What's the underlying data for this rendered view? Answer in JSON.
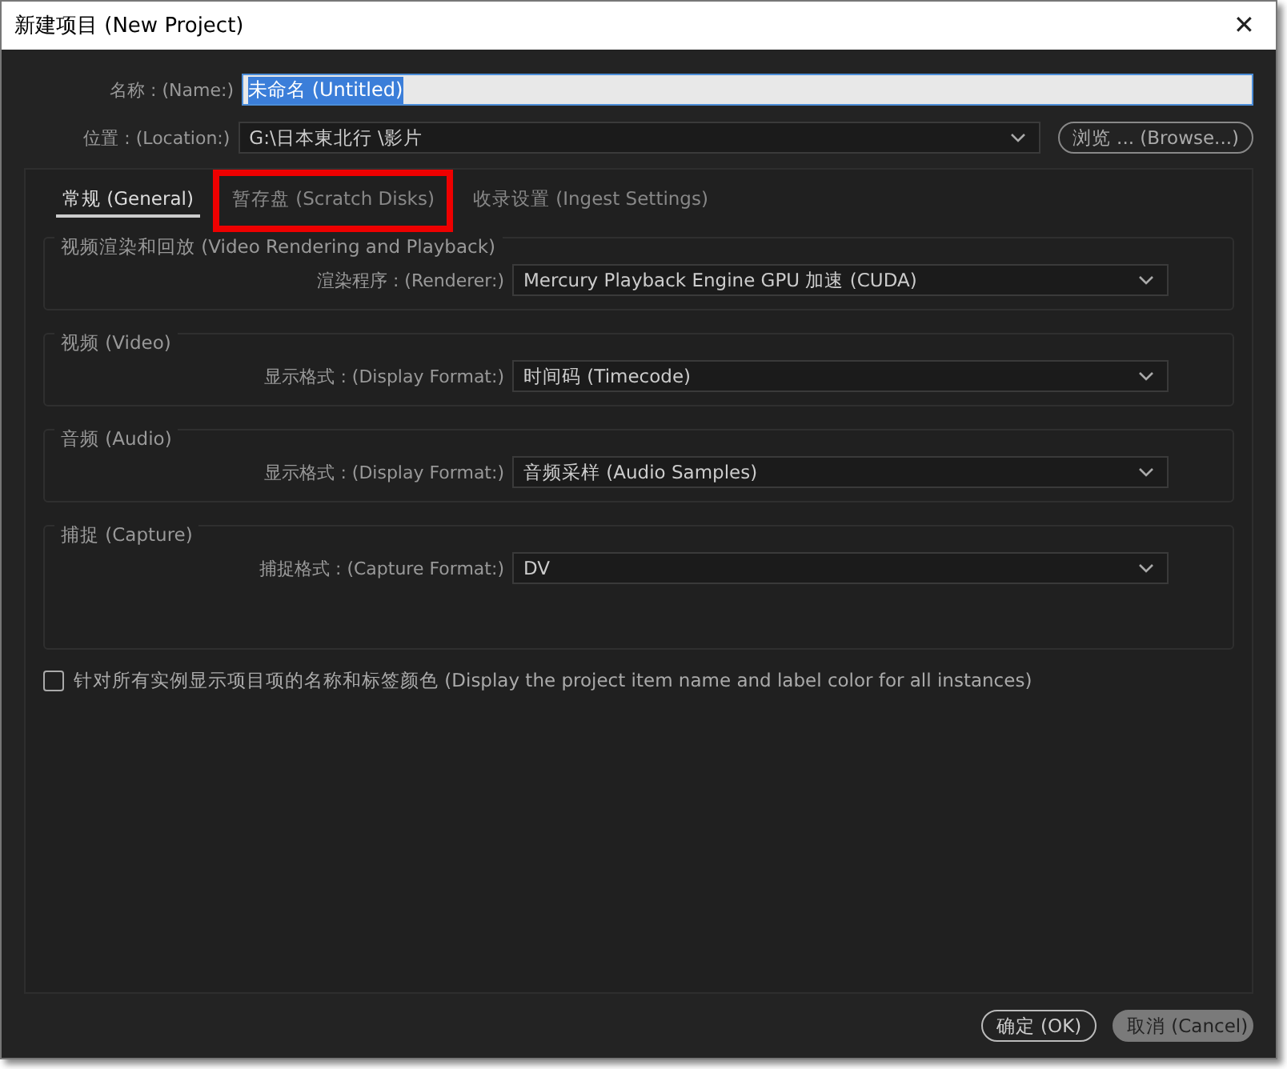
{
  "window": {
    "title": "新建项目 (New Project)",
    "close": "✕"
  },
  "name_field": {
    "label": "名称 : (Name:)",
    "value": "未命名 (Untitled)",
    "text_selected": true
  },
  "location_field": {
    "label": "位置 : (Location:)",
    "value": "G:\\日本東北行 \\影片"
  },
  "browse_button": "浏览 ... (Browse...)",
  "tabs": [
    {
      "label": "常规 (General)",
      "selected": true,
      "highlighted": false
    },
    {
      "label": "暂存盘 (Scratch Disks)",
      "selected": false,
      "highlighted": true
    },
    {
      "label": "收录设置 (Ingest Settings)",
      "selected": false,
      "highlighted": false
    }
  ],
  "groups": [
    {
      "title": "视频渲染和回放 (Video Rendering and Playback)",
      "label": "渲染程序 : (Renderer:)",
      "value": "Mercury Playback Engine GPU 加速 (CUDA)",
      "tall": false
    },
    {
      "title": "视频 (Video)",
      "label": "显示格式 : (Display Format:)",
      "value": "时间码 (Timecode)",
      "tall": false
    },
    {
      "title": "音频 (Audio)",
      "label": "显示格式 : (Display Format:)",
      "value": "音频采样 (Audio Samples)",
      "tall": false
    },
    {
      "title": "捕捉 (Capture)",
      "label": "捕捉格式 : (Capture Format:)",
      "value": "DV",
      "tall": true
    }
  ],
  "label_color_option": {
    "label": "针对所有实例显示项目项的名称和标签颜色 (Display the project item name and label color for all instances)",
    "checked": false
  },
  "buttons": [
    {
      "label": "确定 (OK)",
      "kind": "default"
    },
    {
      "label": "取消 (Cancel)",
      "kind": "cancel"
    }
  ]
}
